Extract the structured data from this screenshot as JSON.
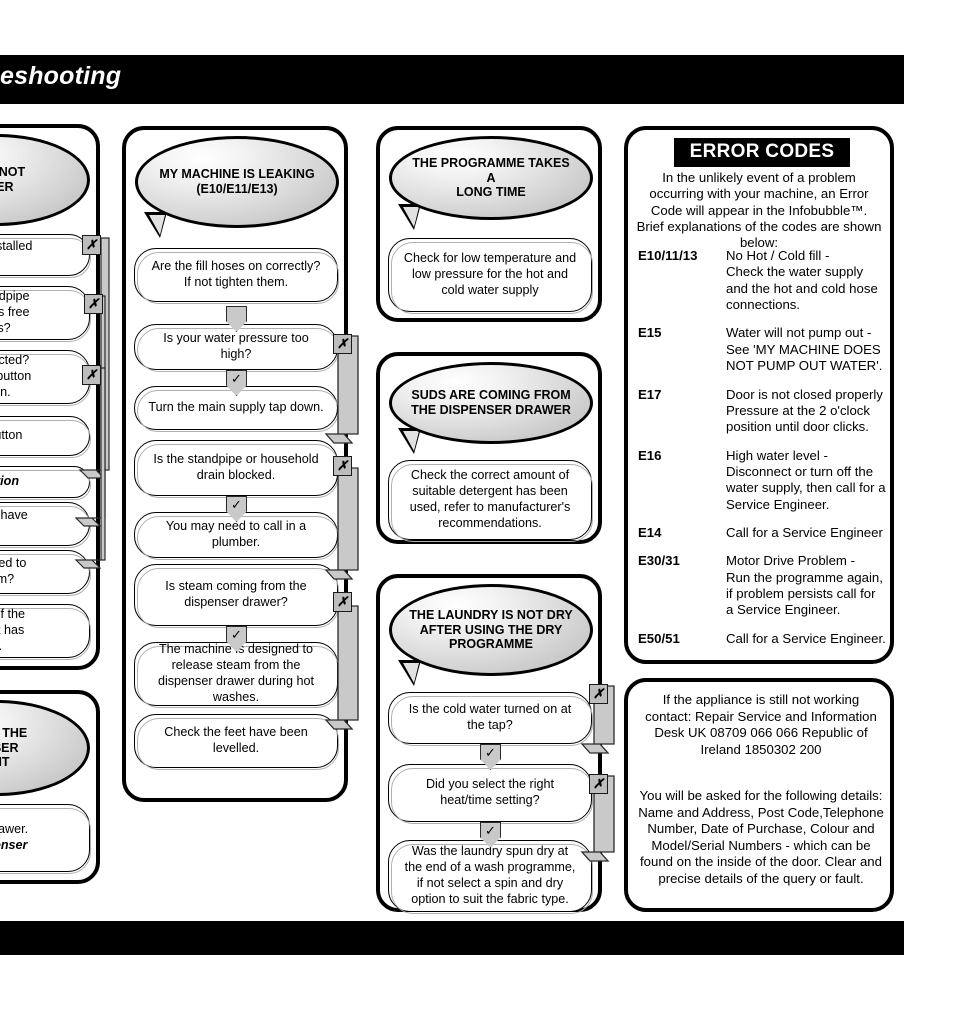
{
  "page": {
    "header_title": "eshooting",
    "colors": {
      "banner": "#000000",
      "bubble_fill": "#d9d9d9",
      "connector": "#c9c9c9",
      "marker_fill": "#bdbdbd",
      "page_background": "#ffffff"
    }
  },
  "column1": {
    "note": "left column is cropped at the page edge; only right-hand fragments of each line are visible",
    "panel_a": {
      "bubble_lines": [
        "OES NOT",
        "ATER"
      ],
      "steps": [
        {
          "text": "een installed\n?",
          "marker": "✗"
        },
        {
          "text": "t, standpipe\nections free\nges?",
          "marker": "✗"
        },
        {
          "text": "n selected?\ntil the button\ngain.",
          "marker": "✗"
        },
        {
          "text": "ld' button",
          "marker": ""
        },
        {
          "text": "allation",
          "marker": "",
          "style": "italic-bold"
        },
        {
          "text": "s that have\nd",
          "marker": ""
        },
        {
          "text": "nnected to\nstem?",
          "marker": ""
        },
        {
          "text": "end of the\ne unit has\nff.",
          "marker": ""
        }
      ]
    },
    "panel_b": {
      "bubble_lines": [
        "TS IN THE",
        "ENSER",
        "ENT"
      ],
      "steps": [
        {
          "line1": "ser drawer.",
          "line2": "Dispenser"
        }
      ]
    }
  },
  "column2": {
    "bubble_lines": [
      "MY MACHINE IS LEAKING",
      "(E10/E11/E13)"
    ],
    "steps": [
      {
        "text": "Are the fill hoses on correctly? If not tighten them."
      },
      {
        "text": "Is your water pressure too high?"
      },
      {
        "text": "Turn the main supply tap down."
      },
      {
        "text": "Is the standpipe or household drain blocked."
      },
      {
        "text": "You may need to call in a plumber."
      },
      {
        "text": "Is steam coming from the dispenser drawer?"
      },
      {
        "text": "The machine is designed to release steam from the dispenser drawer during hot washes."
      },
      {
        "text": "Check the feet have been levelled."
      }
    ],
    "markers": {
      "cross": "✗",
      "tick": "✓"
    }
  },
  "column3": {
    "panel_a": {
      "bubble_lines": [
        "THE PROGRAMME TAKES A",
        "LONG TIME"
      ],
      "steps": [
        {
          "text": "Check for low temperature and low pressure for the hot and cold water supply"
        }
      ]
    },
    "panel_b": {
      "bubble_lines": [
        "SUDS ARE COMING FROM",
        "THE DISPENSER DRAWER"
      ],
      "steps": [
        {
          "text": "Check the correct amount of suitable detergent has been used, refer to manufacturer's recommendations."
        }
      ]
    },
    "panel_c": {
      "bubble_lines": [
        "THE LAUNDRY IS NOT DRY",
        "AFTER USING THE DRY",
        "PROGRAMME"
      ],
      "steps": [
        {
          "text": "Is the cold water turned on at the tap?"
        },
        {
          "text": "Did you select the right heat/time setting?"
        },
        {
          "text": "Was the laundry spun dry at the end of a wash programme, if not select a spin and dry option to suit the fabric type."
        }
      ]
    }
  },
  "error_codes": {
    "title": "ERROR CODES",
    "intro": "In the unlikely event of a problem occurring with your machine, an Error Code will appear in the Infobubble™. Brief explanations of the codes are shown below:",
    "rows": [
      {
        "code": "E10/11/13",
        "desc": "No Hot / Cold fill -\nCheck the water supply\nand the hot and cold hose\nconnections."
      },
      {
        "code": "E15",
        "desc": "Water will not pump out -\nSee 'MY MACHINE DOES\nNOT PUMP OUT WATER'."
      },
      {
        "code": "E17",
        "desc": "Door is not closed properly\nPressure at the 2 o'clock\nposition until door clicks."
      },
      {
        "code": "E16",
        "desc": "High water level -\nDisconnect or turn off the\nwater supply, then call for a\nService Engineer."
      },
      {
        "code": "E14",
        "desc": "Call for a Service Engineer"
      },
      {
        "code": "E30/31",
        "desc": "Motor Drive Problem -\nRun the programme again,\nif problem persists call for\na Service Engineer."
      },
      {
        "code": "E50/51",
        "desc": "Call for a Service Engineer."
      }
    ]
  },
  "contact": {
    "block1": "If the appliance is still not working contact:\nRepair Service and Information Desk\nUK 08709 066 066\nRepublic of Ireland 1850302 200",
    "block2": "You will be asked for the following details: Name and Address, Post Code,Telephone Number, Date of Purchase, Colour and Model/Serial Numbers - which can be found on the inside of the door.\nClear and precise details of the query or fault."
  }
}
